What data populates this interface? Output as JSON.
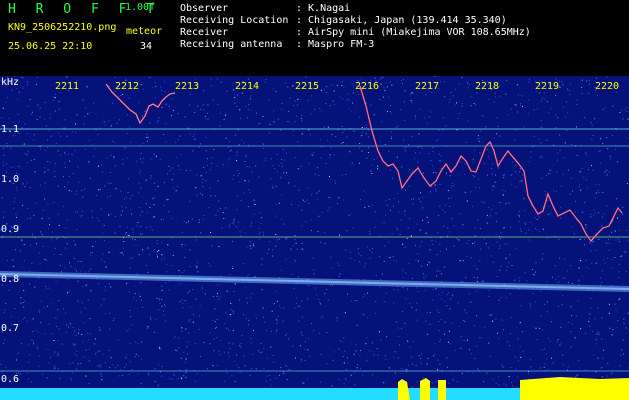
{
  "header": {
    "brand": "H R O F F T",
    "version": "1.00f",
    "filename": "KN9_2506252210.png",
    "meteor_label": "meteor",
    "timestamp": "25.06.25 22:10",
    "meteor_count": "34",
    "info": [
      {
        "key": "Observer",
        "value": ": K.Nagai"
      },
      {
        "key": "Receiving Location",
        "value": ": Chigasaki, Japan (139.414 35.340)"
      },
      {
        "key": "Receiver",
        "value": ": AirSpy mini (Miakejima VOR 108.65MHz)"
      },
      {
        "key": "Receiving antenna",
        "value": ": Maspro FM-3"
      }
    ]
  },
  "spectrogram": {
    "y_unit": "kHz",
    "y_ticks": [
      "1.1",
      "1.0",
      "0.9",
      "0.8",
      "0.7",
      "0.6"
    ],
    "x_ticks": [
      "2211",
      "2212",
      "2213",
      "2214",
      "2215",
      "2216",
      "2217",
      "2218",
      "2219",
      "2220"
    ],
    "colors": {
      "background": "#05127a",
      "label": "#ffff00",
      "trace": "#ff4466",
      "line": "#66ddee",
      "bottom_bar": "#22ddff"
    }
  }
}
